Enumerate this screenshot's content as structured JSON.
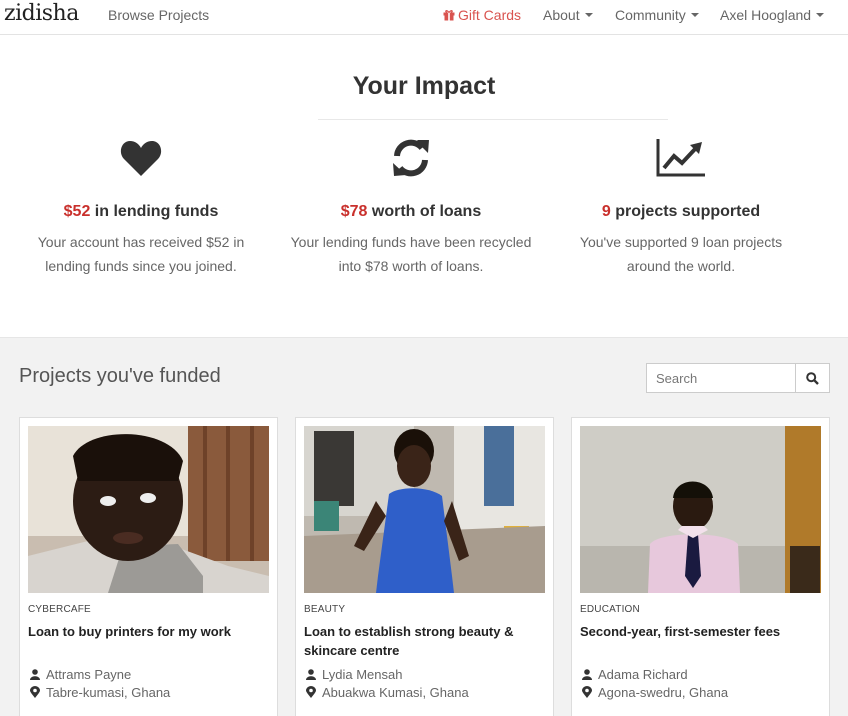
{
  "nav": {
    "logo": "zidisha",
    "browse": "Browse Projects",
    "gift_cards": "Gift Cards",
    "about": "About",
    "community": "Community",
    "user": "Axel Hoogland"
  },
  "impact": {
    "title": "Your Impact",
    "stats": [
      {
        "icon": "heart-icon",
        "amount": "$52",
        "heading": " in lending funds",
        "desc_1": "Your account has received $52 in",
        "desc_2": "lending funds since you joined."
      },
      {
        "icon": "refresh-icon",
        "amount": "$78",
        "heading": " worth of loans",
        "desc_1": "Your lending funds have been recycled",
        "desc_2": "into $78 worth of loans."
      },
      {
        "icon": "line-chart-icon",
        "amount": "9",
        "heading": " projects supported",
        "desc_1": "You've supported 9 loan projects",
        "desc_2": "around the world."
      }
    ]
  },
  "projects": {
    "title": "Projects you've funded",
    "search_placeholder": "Search",
    "cards": [
      {
        "category": "CYBERCAFE",
        "title": "Loan to buy printers for my work",
        "name": "Attrams Payne",
        "location": "Tabre-kumasi, Ghana"
      },
      {
        "category": "BEAUTY",
        "title": "Loan to establish strong beauty & skincare centre",
        "name": "Lydia Mensah",
        "location": "Abuakwa Kumasi, Ghana"
      },
      {
        "category": "EDUCATION",
        "title": "Second-year, first-semester fees",
        "name": "Adama Richard",
        "location": "Agona-swedru, Ghana"
      }
    ]
  },
  "colors": {
    "accent": "#c9302c",
    "gift": "#d9534f",
    "section_bg": "#f2f2f2"
  }
}
